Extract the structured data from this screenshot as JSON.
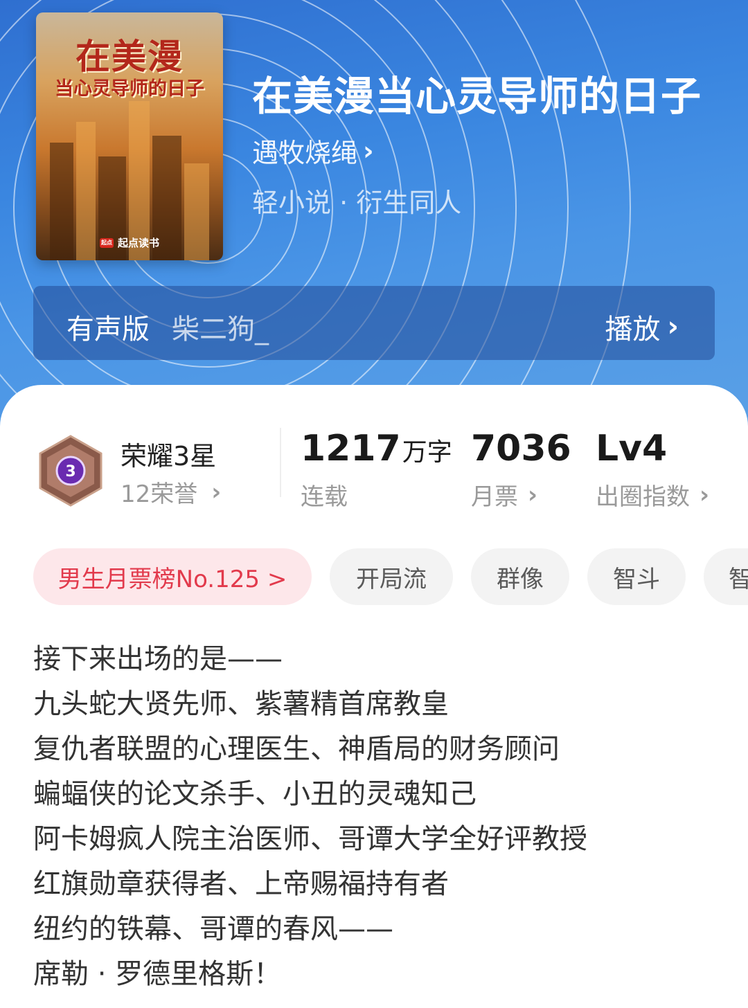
{
  "cover": {
    "title_line1": "在美漫",
    "title_line2": "当心灵导师的日子",
    "brand": "起点读书",
    "brand_mark": "起点"
  },
  "book": {
    "title": "在美漫当心灵导师的日子",
    "author": "遇牧烧绳",
    "genre": "轻小说 · 衍生同人"
  },
  "audio": {
    "label": "有声版",
    "narrator": "柴二狗_",
    "play": "播放"
  },
  "honor": {
    "level": "3",
    "title": "荣耀3星",
    "count": "12荣誉"
  },
  "stats": [
    {
      "value": "1217",
      "unit": "万字",
      "label": "连载"
    },
    {
      "value": "7036",
      "unit": "",
      "label": "月票"
    },
    {
      "value": "Lv4",
      "unit": "",
      "label": "出圈指数"
    }
  ],
  "tags": [
    {
      "label": "男生月票榜No.125 >"
    },
    {
      "label": "开局流"
    },
    {
      "label": "群像"
    },
    {
      "label": "智斗"
    },
    {
      "label": "智"
    }
  ],
  "description": [
    "接下来出场的是——",
    "九头蛇大贤先师、紫薯精首席教皇",
    "复仇者联盟的心理医生、神盾局的财务顾问",
    "蝙蝠侠的论文杀手、小丑的灵魂知己",
    "阿卡姆疯人院主治医师、哥谭大学全好评教授",
    "红旗勋章获得者、上帝赐福持有者",
    "纽约的铁幕、哥谭的春风——",
    "席勒 · 罗德里格斯！"
  ],
  "colors": {
    "hero_blue": "#3a86e0",
    "rank_red": "#e23a4c",
    "badge_purple": "#6a2bb0"
  }
}
